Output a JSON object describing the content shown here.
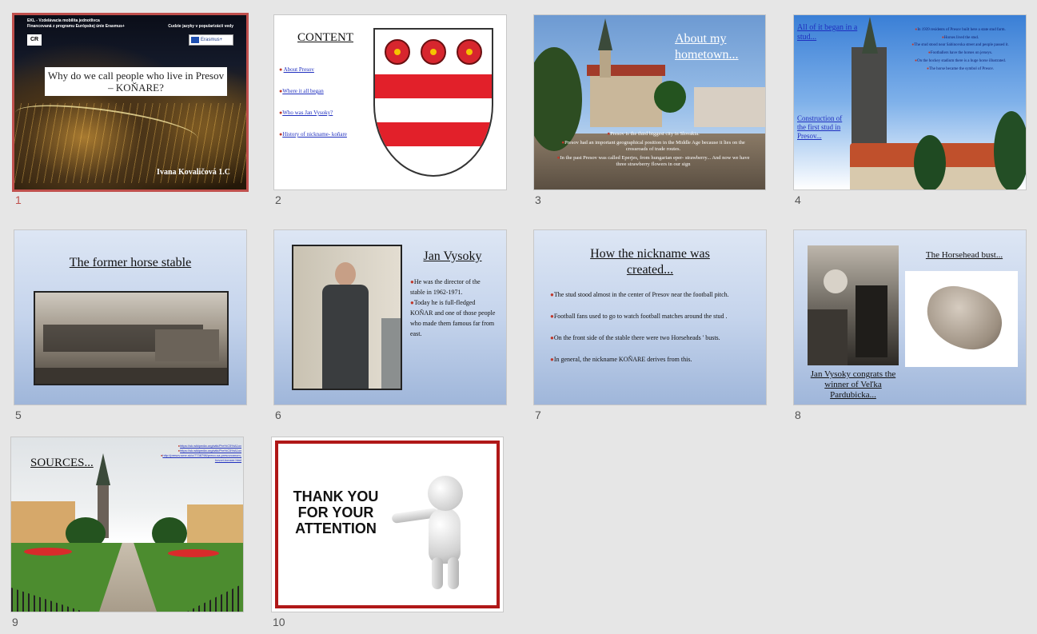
{
  "slides": [
    {
      "number": "1",
      "small_left_1": "EKL - Vzdelávacia mobilita jednotlivca",
      "small_left_2": "Financovaná z programu Európskej únie Erasmus+",
      "small_right": "Cudzie jazyky v popularizácii vedy",
      "logo": "CR",
      "eu_badge": "Erasmus+",
      "title": "Why do we call people who live in Presov – KOŇARE?",
      "author": "Ivana Kovaličová 1.C"
    },
    {
      "number": "2",
      "title": "CONTENT",
      "items": [
        "About Presov",
        "Where it all began",
        "Who was Jan Vysoky?",
        "History of nickname- koňare"
      ]
    },
    {
      "number": "3",
      "title": "About my hometown...",
      "bullets": [
        "Presov is the third biggest city in Slovakia.",
        "Presov had an important geographical position in the Middle   Age because it lies on the crossroads of trade routes.",
        "In the past Presov was called Eperjes, from hungarian eper- strawberry... And now we have three strawberry flowers in our sign"
      ]
    },
    {
      "number": "4",
      "title": "All of it began in a stud...",
      "subtitle": "Construction of the first stud in Presov...",
      "bullets": [
        "In 1939 residents of Presov built here a state stud farm.",
        "Horses lived the stud.",
        "The stud stood near Sabinovska street and people passed it.",
        "Footballers have the horses on jerseys.",
        "On the hockey stadium there is a huge horse illustrated.",
        "The horse became the symbol of Presov."
      ]
    },
    {
      "number": "5",
      "title": "The former horse stable"
    },
    {
      "number": "6",
      "title": "Jan Vysoky",
      "bullets": [
        "He was the director of the stable in 1962-1971.",
        "Today he is full-fledged KOŇAR and one of those people who made them famous far from east."
      ]
    },
    {
      "number": "7",
      "title": "How the nickname was created...",
      "bullets": [
        "The stud stood almost in the center of Presov near the football pitch.",
        "Football fans used to go to watch football matches around the stud .",
        "On the front side of the stable there were two Horseheads ' busts.",
        "In general, the nickname KOŇARE derives from this."
      ]
    },
    {
      "number": "8",
      "title": "The Horsehead bust...",
      "caption": "Jan Vysoky congrats the winner of Veľka Pardubicka..."
    },
    {
      "number": "9",
      "title": "SOURCES...",
      "links": [
        "https://sk.wikipedia.org/wiki/Pre%C5%A1ov",
        "https://sk.wikipedia.org/wiki/Pre%C5%A1ov",
        "http://presov.sme.sk/c/7738798/preco-sa-presovcanom-hovori-konare.html"
      ]
    },
    {
      "number": "10",
      "text": "THANK YOU FOR YOUR ATTENTION"
    }
  ],
  "colors": {
    "selected_border": "#c0504d",
    "bullet": "#c0392b",
    "link": "#1f2fbf"
  }
}
